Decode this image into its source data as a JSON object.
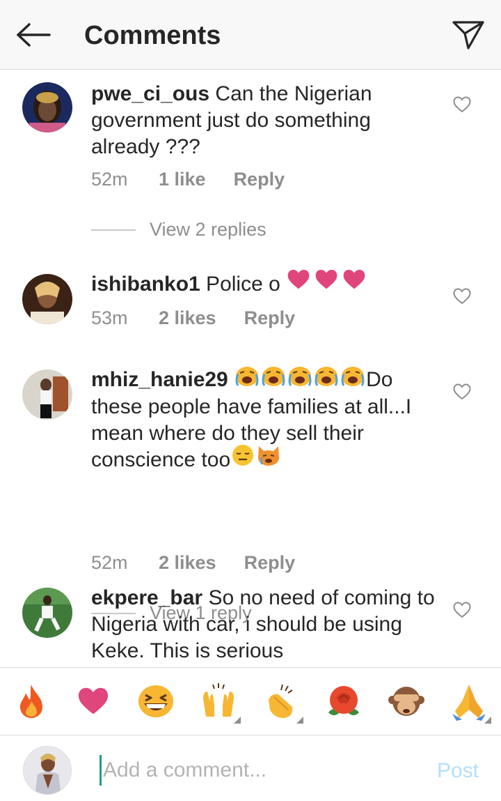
{
  "header": {
    "title": "Comments"
  },
  "comments": [
    {
      "username": "pwe_ci_ous",
      "text": " Can the Nigerian government just do something already ???",
      "time": "52m",
      "likes": "1 like",
      "reply_label": "Reply",
      "view_replies": "View 2 replies"
    },
    {
      "username": "ishibanko1",
      "text": " Police o ",
      "emojis": [
        "pink-heart",
        "pink-heart",
        "pink-heart"
      ],
      "time": "53m",
      "likes": "2 likes",
      "reply_label": "Reply"
    },
    {
      "username": "mhiz_hanie29",
      "emojis_lead": [
        "loudly-crying-face",
        "loudly-crying-face",
        "loudly-crying-face",
        "loudly-crying-face",
        "loudly-crying-face"
      ],
      "text": "Do these people have families at all...I mean where do they sell their conscience too",
      "emojis_tail": [
        "expressionless-face",
        "crying-cat-face"
      ],
      "time": "52m",
      "likes": "2 likes",
      "reply_label": "Reply",
      "view_replies": "View 1 reply"
    },
    {
      "username": "ekpere_bar",
      "text": " So no need of coming to Nigeria with car, i should be using Keke. This is serious"
    }
  ],
  "quick_emojis": [
    "fire",
    "heart",
    "grinning-squint-face",
    "raising-hands",
    "clapping-hands",
    "rose",
    "see-no-evil-monkey",
    "folded-hands"
  ],
  "input": {
    "placeholder": "Add a comment...",
    "post_label": "Post"
  },
  "colors": {
    "text": "#262626",
    "secondary": "#8e8e8e",
    "post_disabled": "#b2dffc",
    "cursor": "#1f9d86",
    "heart_emoji": "#e0457b"
  }
}
